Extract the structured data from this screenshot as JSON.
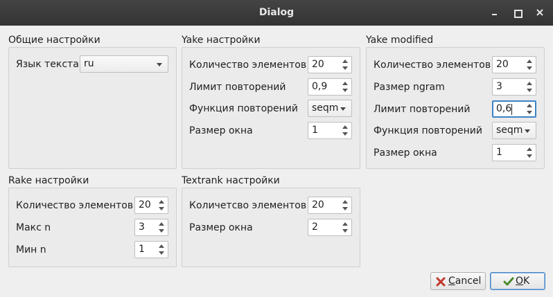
{
  "window": {
    "title": "Dialog"
  },
  "general": {
    "title": "Общие настройки",
    "language_label": "Язык текста",
    "language_value": "ru"
  },
  "yake": {
    "title": "Yake настройки",
    "count_label": "Количество элементов",
    "count_value": "20",
    "limit_label": "Лимит повторений",
    "limit_value": "0,9",
    "func_label": "Функция повторений",
    "func_value": "seqm",
    "window_label": "Размер окна",
    "window_value": "1"
  },
  "yake_modified": {
    "title": "Yake modified",
    "count_label": "Количество элементов",
    "count_value": "20",
    "ngram_label": "Размер ngram",
    "ngram_value": "3",
    "limit_label": "Лимит повторений",
    "limit_value": "0,6",
    "func_label": "Функция повторений",
    "func_value": "seqm",
    "window_label": "Размер окна",
    "window_value": "1"
  },
  "rake": {
    "title": "Rake настройки",
    "count_label": "Количество элементов",
    "count_value": "20",
    "max_label": "Макс n",
    "max_value": "3",
    "min_label": "Мин n",
    "min_value": "1"
  },
  "textrank": {
    "title": "Textrank настройки",
    "count_label": "Количетсво элементов",
    "count_value": "20",
    "window_label": "Размер окна",
    "window_value": "2"
  },
  "buttons": {
    "cancel_mnemonic": "C",
    "cancel_rest": "ancel",
    "ok_mnemonic": "O",
    "ok_rest": "K"
  }
}
